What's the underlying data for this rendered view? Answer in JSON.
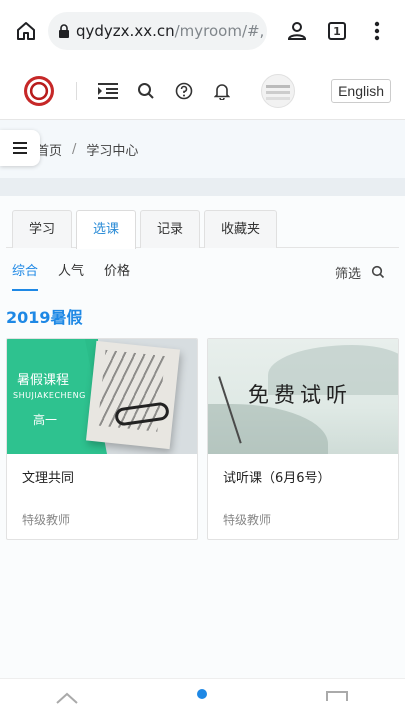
{
  "browser": {
    "url_host": "qydyzx.xx.cn",
    "url_path": "/myroom/#,",
    "tab_count": "1"
  },
  "header": {
    "language_button": "English"
  },
  "breadcrumb": {
    "home": "首页",
    "current": "学习中心"
  },
  "tabs": [
    {
      "label": "学习"
    },
    {
      "label": "选课"
    },
    {
      "label": "记录"
    },
    {
      "label": "收藏夹"
    }
  ],
  "filters": {
    "items": [
      {
        "label": "综合"
      },
      {
        "label": "人气"
      },
      {
        "label": "价格"
      }
    ],
    "filter_label": "筛选"
  },
  "section": {
    "title": "2019暑假"
  },
  "courses": [
    {
      "banner_line1": "暑假课程",
      "banner_line2": "SHUJIAKECHENG",
      "banner_line3": "高一",
      "title": "文理共同",
      "teacher": "特级教师"
    },
    {
      "banner_text": "免费试听",
      "title": "试听课（6月6号）",
      "teacher": "特级教师"
    }
  ],
  "colors": {
    "accent": "#1e88e5",
    "green_banner": "#2ec28f"
  }
}
